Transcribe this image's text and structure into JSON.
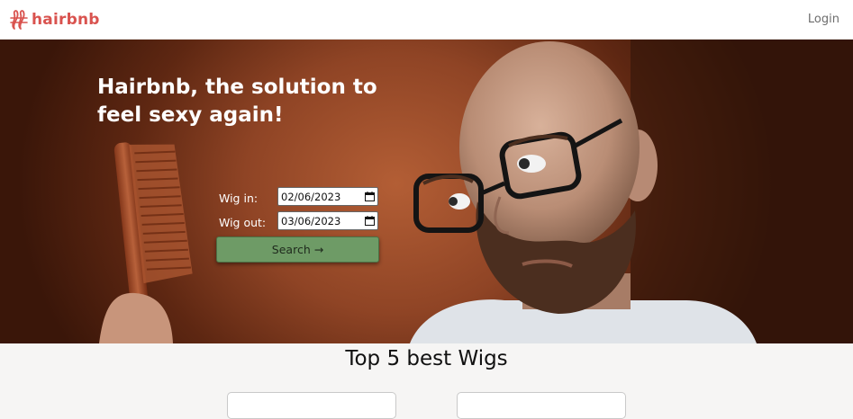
{
  "navbar": {
    "brand_name": "hairbnb",
    "login_label": "Login"
  },
  "hero": {
    "title": "Hairbnb, the solution to feel sexy again!",
    "form": {
      "wig_in_label": "Wig in:",
      "wig_in_value": "02/06/2023",
      "wig_out_label": "Wig out:",
      "wig_out_value": "03/06/2023",
      "search_label": "Search →"
    }
  },
  "wigs_section": {
    "title": "Top 5 best Wigs"
  },
  "colors": {
    "brand": "#d9534f",
    "search_button": "#6e9b66",
    "hero_background": "#8f4425"
  },
  "icons": {
    "logo": "hairbnb-logo-icon",
    "calendar": "calendar-icon"
  }
}
